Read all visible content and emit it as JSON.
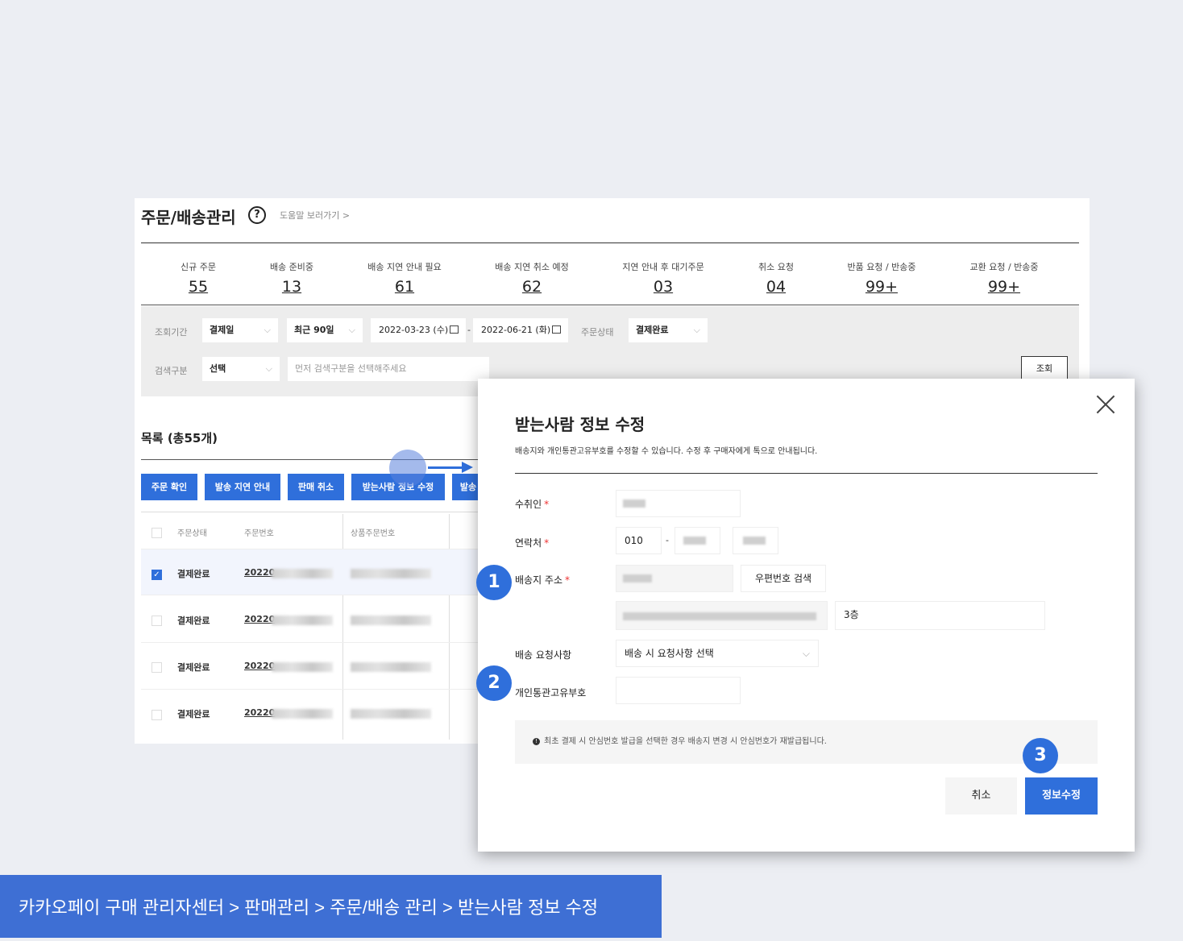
{
  "header": {
    "title": "주문/배송관리",
    "help_link": "도움말 보러가기 >"
  },
  "stats": [
    {
      "label": "신규 주문",
      "value": "55"
    },
    {
      "label": "배송 준비중",
      "value": "13"
    },
    {
      "label": "배송 지연 안내 필요",
      "value": "61"
    },
    {
      "label": "배송 지연 취소 예정",
      "value": "62"
    },
    {
      "label": "지연 안내 후 대기주문",
      "value": "03"
    },
    {
      "label": "취소 요청",
      "value": "04"
    },
    {
      "label": "반품 요청 / 반송중",
      "value": "99+"
    },
    {
      "label": "교환 요청 / 반송중",
      "value": "99+"
    }
  ],
  "filter": {
    "period_label": "조회기간",
    "date_type": "결제일",
    "range": "최근 90일",
    "start_date": "2022-03-23 (수)",
    "date_sep": "-",
    "end_date": "2022-06-21 (화)",
    "status_label": "주문상태",
    "status_value": "결제완료",
    "search_label": "검색구분",
    "search_type": "선택",
    "search_placeholder": "먼저 검색구분을 선택해주세요",
    "inquiry_button": "조회"
  },
  "list": {
    "title": "목록 (총55개)",
    "buttons": [
      "주문 확인",
      "발송 지연 안내",
      "판매 취소",
      "받는사람 정보 수정",
      "발송"
    ],
    "columns": [
      "주문상태",
      "주문번호",
      "상품주문번호"
    ],
    "rows": [
      {
        "status": "결제완료",
        "order_prefix": "20220",
        "checked": true
      },
      {
        "status": "결제완료",
        "order_prefix": "20220",
        "checked": false
      },
      {
        "status": "결제완료",
        "order_prefix": "20220",
        "checked": false
      },
      {
        "status": "결제완료",
        "order_prefix": "20220",
        "checked": false
      }
    ]
  },
  "modal": {
    "title": "받는사람 정보 수정",
    "description": "배송지와 개인통관고유부호를 수정할 수 있습니다. 수정 후 구매자에게 톡으로 안내됩니다.",
    "recipient_label": "수취인",
    "phone_label": "연락처",
    "phone_prefix": "010",
    "phone_sep": "-",
    "address_label": "배송지 주소",
    "zipcode_button": "우편번호 검색",
    "address_detail": "3층",
    "request_label": "배송 요청사항",
    "request_select": "배송 시 요청사항 선택",
    "customs_label": "개인통관고유부호",
    "required_mark": "*",
    "notice": "최초 결제 시 안심번호 발급을 선택한 경우 배송지 변경 시 안심번호가 재발급됩니다.",
    "notice_icon_glyph": "!",
    "cancel_button": "취소",
    "save_button": "정보수정"
  },
  "markers": [
    "1",
    "2",
    "3"
  ],
  "footer": {
    "breadcrumb": "카카오페이 구매 관리자센터 > 판매관리 > 주문/배송 관리 > 받는사람 정보 수정"
  },
  "colors": {
    "accent": "#2f6fdb",
    "footer_bg": "#3e6fd4",
    "page_bg": "#eceef3"
  }
}
